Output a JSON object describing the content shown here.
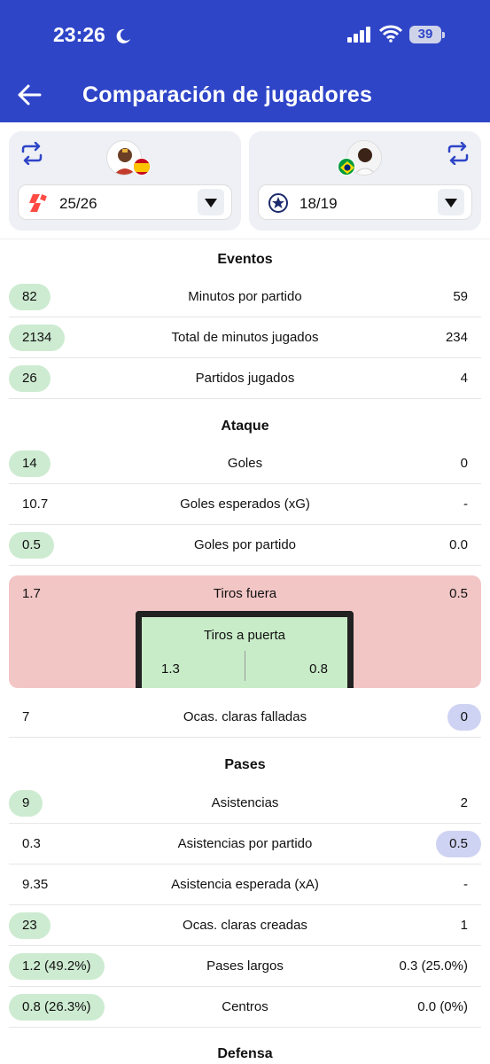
{
  "status": {
    "time": "23:26",
    "battery": "39"
  },
  "header": {
    "title": "Comparación de jugadores"
  },
  "players": {
    "left": {
      "season": "25/26"
    },
    "right": {
      "season": "18/19"
    }
  },
  "sections": {
    "eventos": "Eventos",
    "ataque": "Ataque",
    "pases": "Pases",
    "defensa": "Defensa"
  },
  "eventos": [
    {
      "label": "Minutos por partido",
      "left": "82",
      "right": "59"
    },
    {
      "label": "Total de minutos jugados",
      "left": "2134",
      "right": "234"
    },
    {
      "label": "Partidos jugados",
      "left": "26",
      "right": "4"
    }
  ],
  "ataque": [
    {
      "label": "Goles",
      "left": "14",
      "right": "0"
    },
    {
      "label": "Goles esperados (xG)",
      "left": "10.7",
      "right": "-"
    },
    {
      "label": "Goles por partido",
      "left": "0.5",
      "right": "0.0"
    }
  ],
  "shots": {
    "off_label": "Tiros fuera",
    "off_left": "1.7",
    "off_right": "0.5",
    "on_label": "Tiros a puerta",
    "on_left": "1.3",
    "on_right": "0.8"
  },
  "big_chances_missed": {
    "label": "Ocas. claras falladas",
    "left": "7",
    "right": "0"
  },
  "pases": [
    {
      "label": "Asistencias",
      "left": "9",
      "right": "2"
    },
    {
      "label": "Asistencias por partido",
      "left": "0.3",
      "right": "0.5"
    },
    {
      "label": "Asistencia esperada (xA)",
      "left": "9.35",
      "right": "-"
    },
    {
      "label": "Ocas. claras creadas",
      "left": "23",
      "right": "1"
    },
    {
      "label": "Pases largos",
      "left": "1.2 (49.2%)",
      "right": "0.3 (25.0%)"
    },
    {
      "label": "Centros",
      "left": "0.8 (26.3%)",
      "right": "0.0 (0%)"
    }
  ],
  "colors": {
    "header": "#2f45c8",
    "left_better": "#cdebd1",
    "right_better": "#cfd3f3",
    "shots_bg": "#f3c6c6"
  }
}
